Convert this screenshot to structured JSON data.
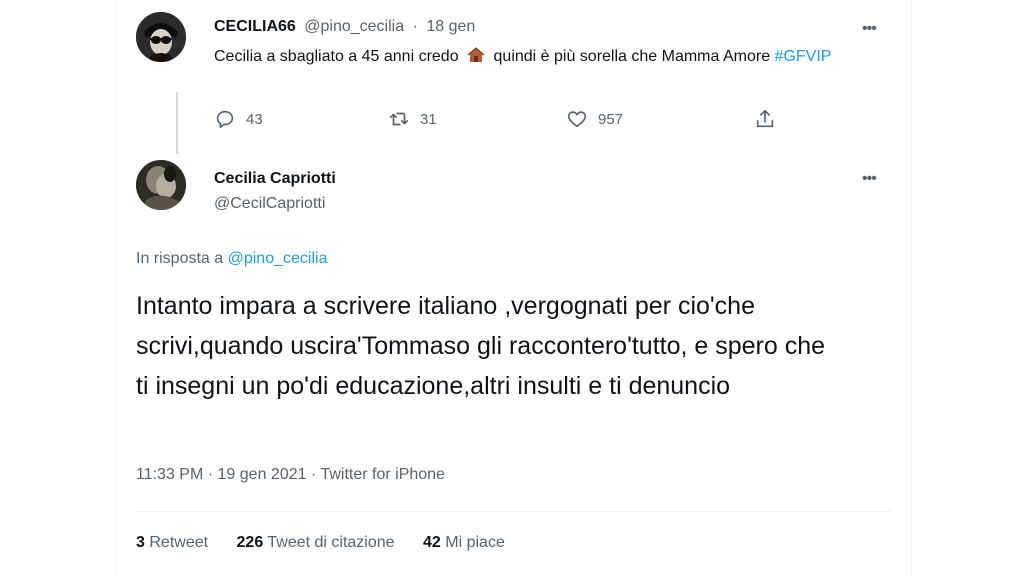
{
  "tweet1": {
    "display_name": "CECILIA66",
    "handle": "@pino_cecilia",
    "separator": "·",
    "date": "18 gen",
    "text_before_emoji": "Cecilia a sbagliato a 45 anni credo",
    "emoji": "house-emoji",
    "text_after_emoji": "quindi è più sorella che Mamma Amore",
    "hashtag": "#GFVIP",
    "more": "•••",
    "replies": "43",
    "retweets": "31",
    "likes": "957"
  },
  "tweet2": {
    "display_name": "Cecilia Capriotti",
    "handle": "@CecilCapriotti",
    "more": "•••",
    "reply_prefix": "In risposta a",
    "reply_handle": "@pino_cecilia",
    "text": "Intanto impara a scrivere italiano ,vergognati per cio'che scrivi,quando uscira'Tommaso gli raccontero'tutto, e spero che ti insegni un po'di educazione,altri insulti e ti denuncio",
    "time": "11:33 PM",
    "separator": "·",
    "date": "19 gen 2021",
    "source": "Twitter for iPhone",
    "stats": {
      "retweets_count": "3",
      "retweets_label": "Retweet",
      "quotes_count": "226",
      "quotes_label": "Tweet di citazione",
      "likes_count": "42",
      "likes_label": "Mi piace"
    }
  },
  "colors": {
    "text": "#0f1419",
    "muted": "#536471",
    "link": "#1d9bf0",
    "divider": "#eff3f4"
  }
}
